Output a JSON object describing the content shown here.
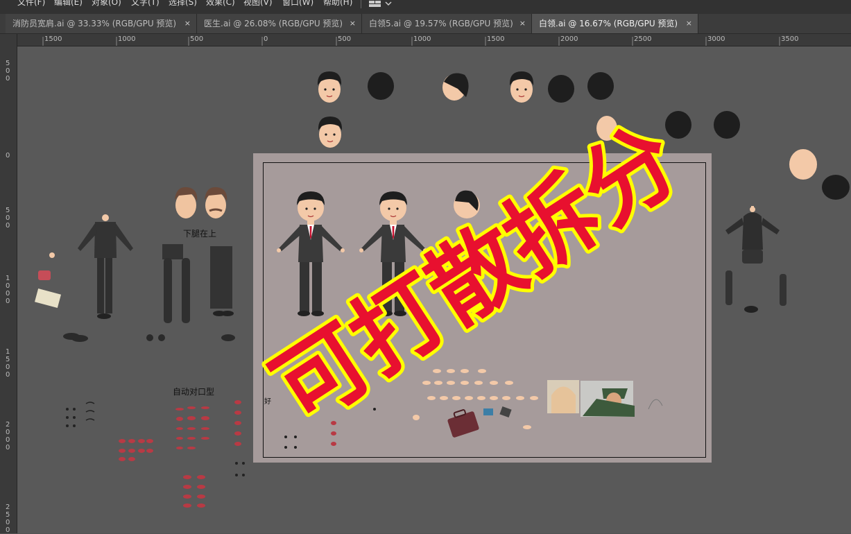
{
  "menu": [
    "文件(F)",
    "编辑(E)",
    "对象(O)",
    "文字(T)",
    "选择(S)",
    "效果(C)",
    "视图(V)",
    "窗口(W)",
    "帮助(H)"
  ],
  "tabs": [
    {
      "label": "消防员宽肩.ai @ 33.33% (RGB/GPU 预览)",
      "close": "×"
    },
    {
      "label": "医生.ai @ 26.08% (RGB/GPU 预览)",
      "close": "×"
    },
    {
      "label": "白领5.ai @ 19.57% (RGB/GPU 预览)",
      "close": "×"
    },
    {
      "label": "白领.ai @ 16.67% (RGB/GPU 预览)",
      "close": "×"
    }
  ],
  "ruler_top": [
    "1500",
    "1000",
    "500",
    "0",
    "500",
    "1000",
    "1500",
    "2000",
    "2500",
    "3000",
    "3500"
  ],
  "ruler_left": [
    "5\n0\n0",
    "0",
    "5\n0\n0",
    "1\n0\n0\n0",
    "1\n5\n0\n0",
    "2\n0\n0\n0",
    "2\n5\n0\n0"
  ],
  "labels": {
    "lower_leg": "下腿在上",
    "lip_sync": "自动对口型",
    "small": "好"
  },
  "overlay_text": "可打散拆分",
  "colors": {
    "overlay_fill": "#e8102f",
    "overlay_stroke": "#ffff00",
    "suit": "#3a3a3a",
    "skin": "#f3c9a8",
    "hair": "#1e1e1e",
    "artboard": "#a69b9b"
  }
}
